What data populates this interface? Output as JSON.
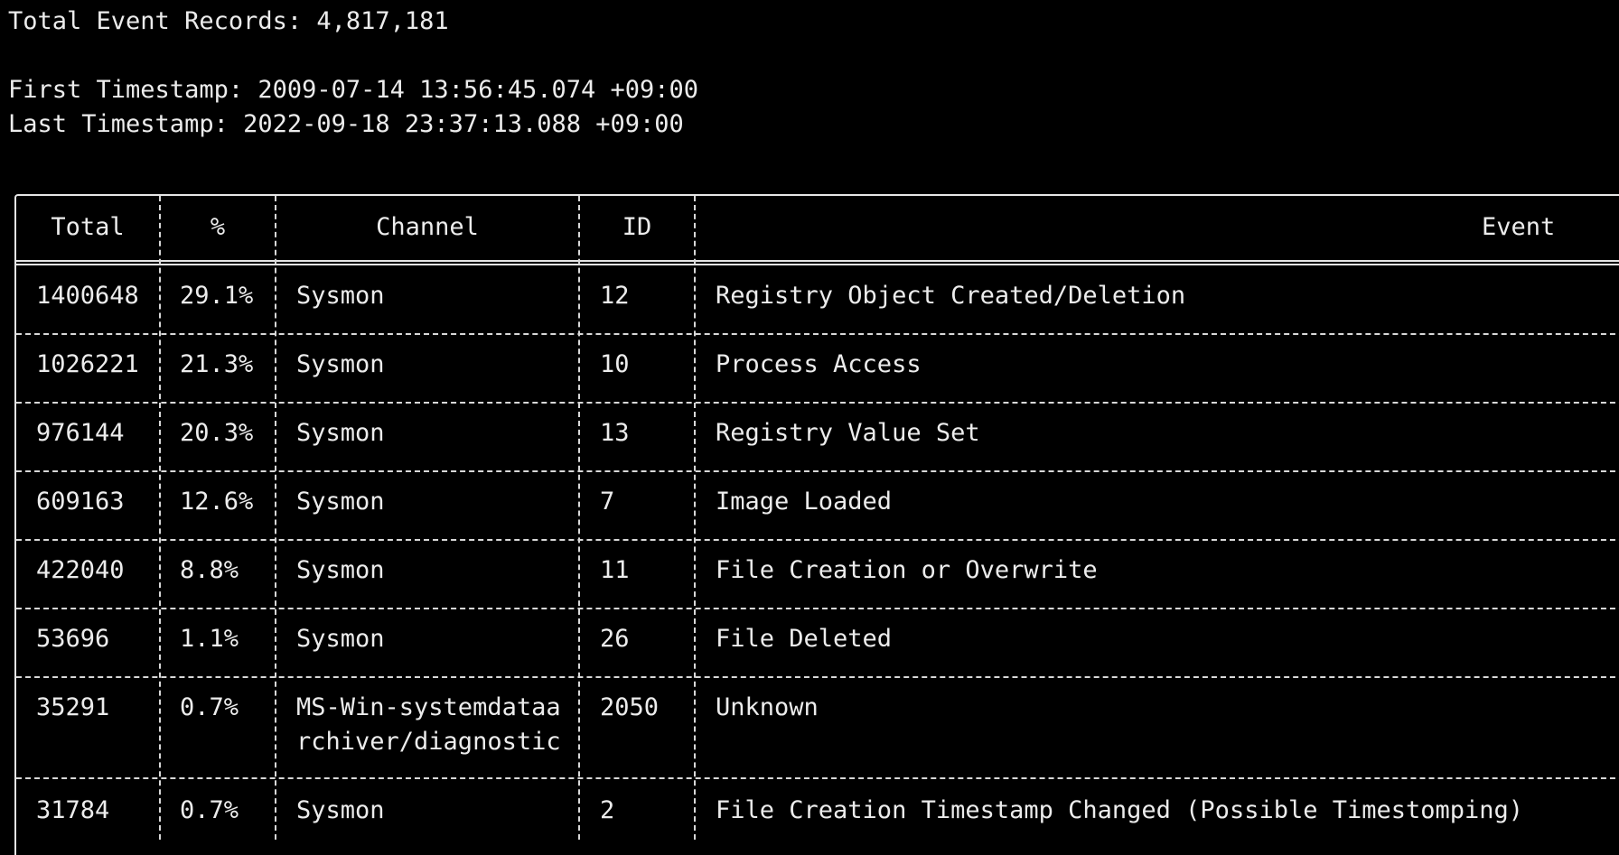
{
  "summary": {
    "total_label": "Total Event Records:",
    "total_value": "4,817,181",
    "first_label": "First Timestamp:",
    "first_value": "2009-07-14 13:56:45.074 +09:00",
    "last_label": "Last Timestamp:",
    "last_value": "2022-09-18 23:37:13.088 +09:00"
  },
  "table": {
    "headers": [
      "Total",
      "%",
      "Channel",
      "ID",
      "Event"
    ],
    "rows": [
      {
        "total": "1400648",
        "pct": "29.1%",
        "channel": "Sysmon",
        "channel2": "",
        "id": "12",
        "event": "Registry Object Created/Deletion"
      },
      {
        "total": "1026221",
        "pct": "21.3%",
        "channel": "Sysmon",
        "channel2": "",
        "id": "10",
        "event": "Process Access"
      },
      {
        "total": "976144",
        "pct": "20.3%",
        "channel": "Sysmon",
        "channel2": "",
        "id": "13",
        "event": "Registry Value Set"
      },
      {
        "total": "609163",
        "pct": "12.6%",
        "channel": "Sysmon",
        "channel2": "",
        "id": "7",
        "event": "Image Loaded"
      },
      {
        "total": "422040",
        "pct": "8.8%",
        "channel": "Sysmon",
        "channel2": "",
        "id": "11",
        "event": "File Creation or Overwrite"
      },
      {
        "total": "53696",
        "pct": "1.1%",
        "channel": "Sysmon",
        "channel2": "",
        "id": "26",
        "event": "File Deleted"
      },
      {
        "total": "35291",
        "pct": "0.7%",
        "channel": "MS-Win-systemdataa",
        "channel2": "rchiver/diagnostic",
        "id": "2050",
        "event": "Unknown"
      },
      {
        "total": "31784",
        "pct": "0.7%",
        "channel": "Sysmon",
        "channel2": "",
        "id": "2",
        "event": "File Creation Timestamp Changed (Possible Timestomping)"
      }
    ]
  }
}
